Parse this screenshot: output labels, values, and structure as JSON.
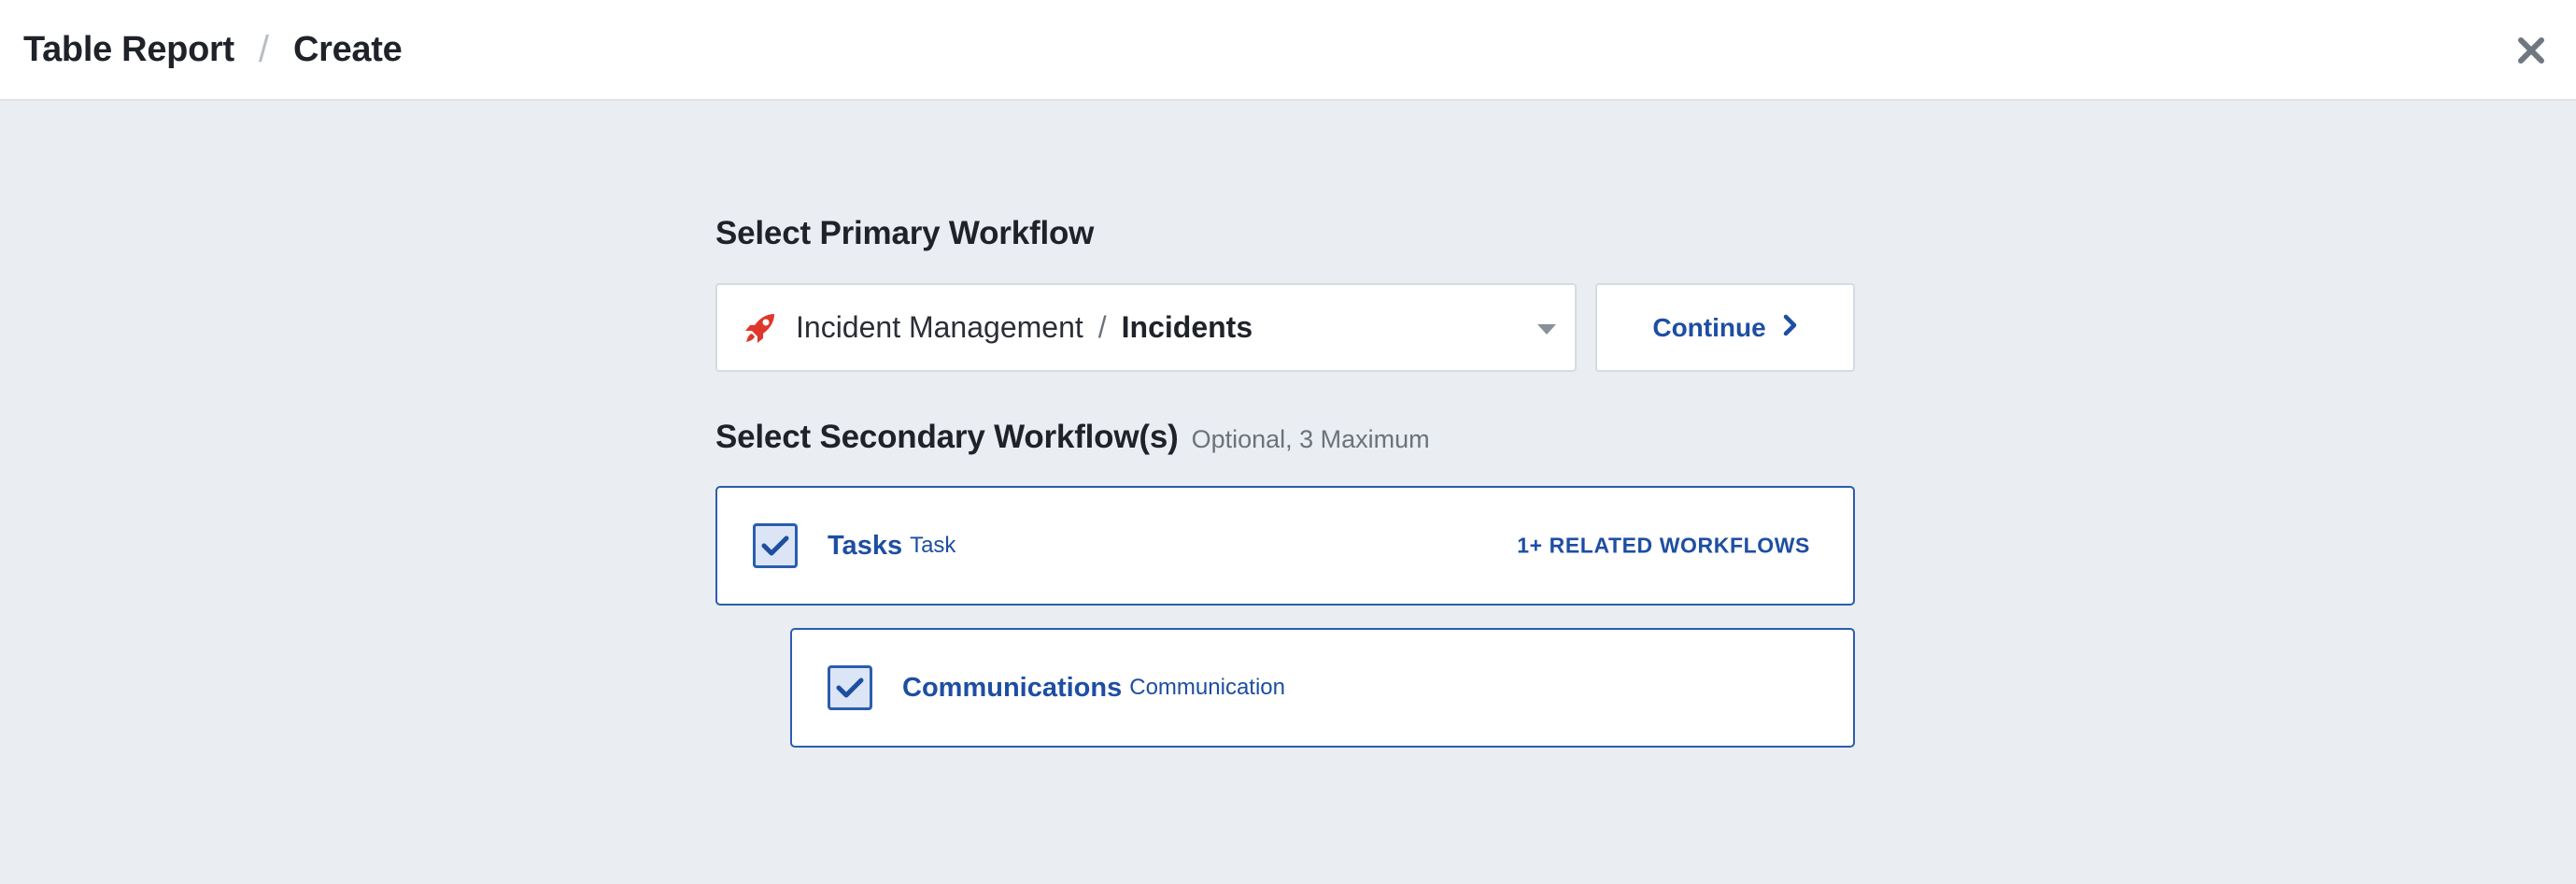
{
  "header": {
    "breadcrumb_root": "Table Report",
    "breadcrumb_separator": "/",
    "breadcrumb_current": "Create",
    "close_icon": "close-icon"
  },
  "primary": {
    "title": "Select Primary Workflow",
    "selected_app": "Incident Management",
    "separator": "/",
    "selected_workflow": "Incidents",
    "app_icon": "rocket-icon",
    "app_icon_color": "#e0362b",
    "continue_label": "Continue"
  },
  "secondary": {
    "title": "Select Secondary Workflow(s)",
    "hint": "Optional, 3 Maximum",
    "items": [
      {
        "name": "Tasks",
        "type": "Task",
        "checked": true,
        "related_label": "1+ RELATED WORKFLOWS"
      },
      {
        "name": "Communications",
        "type": "Communication",
        "checked": true
      }
    ]
  },
  "colors": {
    "accent": "#1d4ea2",
    "background": "#eaedf1"
  }
}
